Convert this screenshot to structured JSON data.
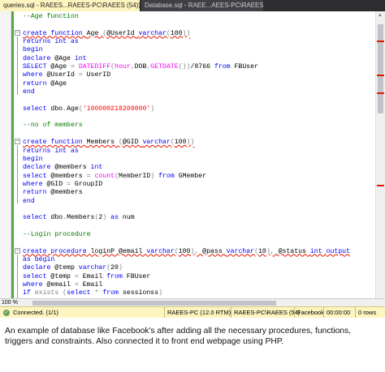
{
  "tabs": [
    {
      "label": "queries.sql - RAEES...RAEES-PC\\RAEES (54))",
      "close": "×"
    },
    {
      "label": "Database.sql - RAEE...AEES-PC\\RAEES (52))",
      "close": ""
    }
  ],
  "code_lines": [
    [
      {
        "t": "--Age function",
        "c": "cmt"
      }
    ],
    [],
    [
      {
        "t": "create function ",
        "c": "kw sq"
      },
      {
        "t": "Age ",
        "c": "sq"
      },
      {
        "t": "(",
        "c": "op sq"
      },
      {
        "t": "@UserId ",
        "c": "sq"
      },
      {
        "t": "varchar",
        "c": "kw sq"
      },
      {
        "t": "(",
        "c": "op sq"
      },
      {
        "t": "100",
        "c": "sq"
      },
      {
        "t": "))",
        "c": "op sq"
      }
    ],
    [
      {
        "t": "returns ",
        "c": "kw"
      },
      {
        "t": "int ",
        "c": "kw"
      },
      {
        "t": "as",
        "c": "kw"
      }
    ],
    [
      {
        "t": "begin",
        "c": "kw"
      }
    ],
    [
      {
        "t": "declare ",
        "c": "kw"
      },
      {
        "t": "@Age "
      },
      {
        "t": "int",
        "c": "kw"
      }
    ],
    [
      {
        "t": "SELECT ",
        "c": "kw"
      },
      {
        "t": "@Age "
      },
      {
        "t": "= ",
        "c": "op"
      },
      {
        "t": "DATEDIFF",
        "c": "fn"
      },
      {
        "t": "(",
        "c": "op"
      },
      {
        "t": "hour",
        "c": "fn"
      },
      {
        "t": ",",
        "c": "op"
      },
      {
        "t": "DOB"
      },
      {
        "t": ",",
        "c": "op"
      },
      {
        "t": "GETDATE",
        "c": "fn"
      },
      {
        "t": "())",
        "c": "op"
      },
      {
        "t": "/8766 "
      },
      {
        "t": "from ",
        "c": "kw"
      },
      {
        "t": "FBUser"
      }
    ],
    [
      {
        "t": "where ",
        "c": "kw"
      },
      {
        "t": "@UserId "
      },
      {
        "t": "= ",
        "c": "op"
      },
      {
        "t": "UserID"
      }
    ],
    [
      {
        "t": "return ",
        "c": "kw"
      },
      {
        "t": "@Age"
      }
    ],
    [
      {
        "t": "end",
        "c": "kw"
      }
    ],
    [],
    [
      {
        "t": "select ",
        "c": "kw"
      },
      {
        "t": "dbo"
      },
      {
        "t": ".",
        "c": "op"
      },
      {
        "t": "Age"
      },
      {
        "t": "(",
        "c": "op"
      },
      {
        "t": "'100000218208800'",
        "c": "str"
      },
      {
        "t": ")",
        "c": "op"
      }
    ],
    [],
    [
      {
        "t": "--no of members",
        "c": "cmt"
      }
    ],
    [],
    [
      {
        "t": "create function ",
        "c": "kw sq"
      },
      {
        "t": "Members ",
        "c": "sq"
      },
      {
        "t": "(",
        "c": "op sq"
      },
      {
        "t": "@GID ",
        "c": "sq"
      },
      {
        "t": "varchar",
        "c": "kw sq"
      },
      {
        "t": "(",
        "c": "op sq"
      },
      {
        "t": "100",
        "c": "sq"
      },
      {
        "t": "))",
        "c": "op sq"
      }
    ],
    [
      {
        "t": "returns ",
        "c": "kw"
      },
      {
        "t": "int ",
        "c": "kw"
      },
      {
        "t": "as",
        "c": "kw"
      }
    ],
    [
      {
        "t": "begin",
        "c": "kw"
      }
    ],
    [
      {
        "t": "declare ",
        "c": "kw"
      },
      {
        "t": "@members "
      },
      {
        "t": "int",
        "c": "kw"
      }
    ],
    [
      {
        "t": "select ",
        "c": "kw"
      },
      {
        "t": "@members "
      },
      {
        "t": "= ",
        "c": "op"
      },
      {
        "t": "count",
        "c": "fn"
      },
      {
        "t": "(",
        "c": "op"
      },
      {
        "t": "MemberID"
      },
      {
        "t": ") ",
        "c": "op"
      },
      {
        "t": "from ",
        "c": "kw"
      },
      {
        "t": "GMember"
      }
    ],
    [
      {
        "t": "where ",
        "c": "kw"
      },
      {
        "t": "@GID "
      },
      {
        "t": "= ",
        "c": "op"
      },
      {
        "t": "GroupID"
      }
    ],
    [
      {
        "t": "return ",
        "c": "kw"
      },
      {
        "t": "@members"
      }
    ],
    [
      {
        "t": "end",
        "c": "kw"
      }
    ],
    [],
    [
      {
        "t": "select ",
        "c": "kw"
      },
      {
        "t": "dbo"
      },
      {
        "t": ".",
        "c": "op"
      },
      {
        "t": "Members"
      },
      {
        "t": "(",
        "c": "op"
      },
      {
        "t": "2"
      },
      {
        "t": ") ",
        "c": "op"
      },
      {
        "t": "as ",
        "c": "kw"
      },
      {
        "t": "num"
      }
    ],
    [],
    [
      {
        "t": "--Login procedure",
        "c": "cmt"
      }
    ],
    [],
    [
      {
        "t": "create procedure ",
        "c": "kw sq"
      },
      {
        "t": "loginP ",
        "c": "sq"
      },
      {
        "t": "@email ",
        "c": "sq"
      },
      {
        "t": "varchar",
        "c": "kw sq"
      },
      {
        "t": "(",
        "c": "op sq"
      },
      {
        "t": "100",
        "c": "sq"
      },
      {
        "t": "), ",
        "c": "op sq"
      },
      {
        "t": "@pass ",
        "c": "sq"
      },
      {
        "t": "varchar",
        "c": "kw sq"
      },
      {
        "t": "(",
        "c": "op sq"
      },
      {
        "t": "10",
        "c": "sq"
      },
      {
        "t": "), ",
        "c": "op sq"
      },
      {
        "t": "@status ",
        "c": "sq"
      },
      {
        "t": "int ",
        "c": "kw sq"
      },
      {
        "t": "output",
        "c": "kw sq"
      }
    ],
    [
      {
        "t": "as ",
        "c": "kw"
      },
      {
        "t": "begin",
        "c": "kw"
      }
    ],
    [
      {
        "t": "declare ",
        "c": "kw"
      },
      {
        "t": "@temp "
      },
      {
        "t": "varchar",
        "c": "kw"
      },
      {
        "t": "(",
        "c": "op"
      },
      {
        "t": "20"
      },
      {
        "t": ")",
        "c": "op"
      }
    ],
    [
      {
        "t": "select ",
        "c": "kw"
      },
      {
        "t": "@temp "
      },
      {
        "t": "= ",
        "c": "op"
      },
      {
        "t": "Email "
      },
      {
        "t": "from ",
        "c": "kw"
      },
      {
        "t": "FBUser"
      }
    ],
    [
      {
        "t": "where ",
        "c": "kw"
      },
      {
        "t": "@email "
      },
      {
        "t": "= ",
        "c": "op"
      },
      {
        "t": "Email"
      }
    ],
    [
      {
        "t": "if ",
        "c": "kw"
      },
      {
        "t": "exists ",
        "c": "op"
      },
      {
        "t": "(",
        "c": "op"
      },
      {
        "t": "select ",
        "c": "kw"
      },
      {
        "t": "* ",
        "c": "op"
      },
      {
        "t": "from ",
        "c": "kw"
      },
      {
        "t": "sessionss"
      },
      {
        "t": ")",
        "c": "op"
      }
    ]
  ],
  "zoom": "100 %",
  "status": {
    "connection": "Connected. (1/1)",
    "server": "RAEES-PC (12.0 RTM)",
    "user": "RAEES-PC\\RAEES (54)",
    "database": "Facebook",
    "time": "00:00:00",
    "rows": "0 rows"
  },
  "caption": "An example of database like Facebook's after adding all the necessary procedures, functions, triggers and constraints. Also connected it to front end webpage using PHP.",
  "colors": {
    "keyword": "#0000ff",
    "function": "#ff00ff",
    "string": "#ff0000",
    "comment": "#008000",
    "status_bg": "#fdf4bf"
  },
  "icons": [
    "close-icon",
    "connected-icon",
    "fold-icon"
  ]
}
